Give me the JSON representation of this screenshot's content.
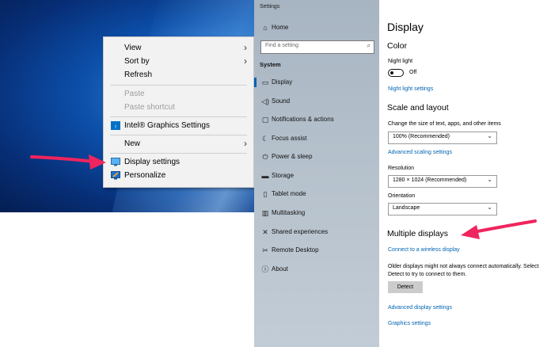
{
  "context_menu": {
    "items": [
      {
        "label": "View",
        "has_submenu": true,
        "disabled": false
      },
      {
        "label": "Sort by",
        "has_submenu": true,
        "disabled": false
      },
      {
        "label": "Refresh",
        "has_submenu": false,
        "disabled": false
      },
      {
        "label": "Paste",
        "has_submenu": false,
        "disabled": true
      },
      {
        "label": "Paste shortcut",
        "has_submenu": false,
        "disabled": true
      },
      {
        "label": "Intel® Graphics Settings",
        "icon": "intel-icon",
        "has_submenu": false,
        "disabled": false
      },
      {
        "label": "New",
        "has_submenu": true,
        "disabled": false
      },
      {
        "label": "Display settings",
        "icon": "display-icon",
        "has_submenu": false,
        "disabled": false
      },
      {
        "label": "Personalize",
        "icon": "personalize-icon",
        "has_submenu": false,
        "disabled": false
      }
    ]
  },
  "settings": {
    "window_title": "Settings",
    "home": {
      "label": "Home",
      "icon": "home-icon"
    },
    "search": {
      "placeholder": "Find a setting",
      "icon": "search-icon"
    },
    "section": "System",
    "nav": [
      {
        "label": "Display",
        "icon": "display-icon",
        "active": true
      },
      {
        "label": "Sound",
        "icon": "sound-icon"
      },
      {
        "label": "Notifications & actions",
        "icon": "notifications-icon"
      },
      {
        "label": "Focus assist",
        "icon": "moon-icon"
      },
      {
        "label": "Power & sleep",
        "icon": "power-icon"
      },
      {
        "label": "Storage",
        "icon": "storage-icon"
      },
      {
        "label": "Tablet mode",
        "icon": "tablet-icon"
      },
      {
        "label": "Multitasking",
        "icon": "multitasking-icon"
      },
      {
        "label": "Shared experiences",
        "icon": "shared-icon"
      },
      {
        "label": "Remote Desktop",
        "icon": "remote-icon"
      },
      {
        "label": "About",
        "icon": "info-icon"
      }
    ]
  },
  "display": {
    "title": "Display",
    "color_heading": "Color",
    "night_light_label": "Night light",
    "night_light_state": "Off",
    "night_light_link": "Night light settings",
    "scale_heading": "Scale and layout",
    "scale_label": "Change the size of text, apps, and other items",
    "scale_value": "100% (Recommended)",
    "advanced_scaling_link": "Advanced scaling settings",
    "resolution_label": "Resolution",
    "resolution_value": "1280 × 1024 (Recommended)",
    "orientation_label": "Orientation",
    "orientation_value": "Landscape",
    "multiple_heading": "Multiple displays",
    "wireless_link": "Connect to a wireless display",
    "older_text": "Older displays might not always connect automatically. Select Detect to try to connect to them.",
    "detect_button": "Detect",
    "advanced_display_link": "Advanced display settings",
    "graphics_link": "Graphics settings"
  },
  "colors": {
    "accent": "#0063b1",
    "annotation_arrow": "#f0245e"
  }
}
